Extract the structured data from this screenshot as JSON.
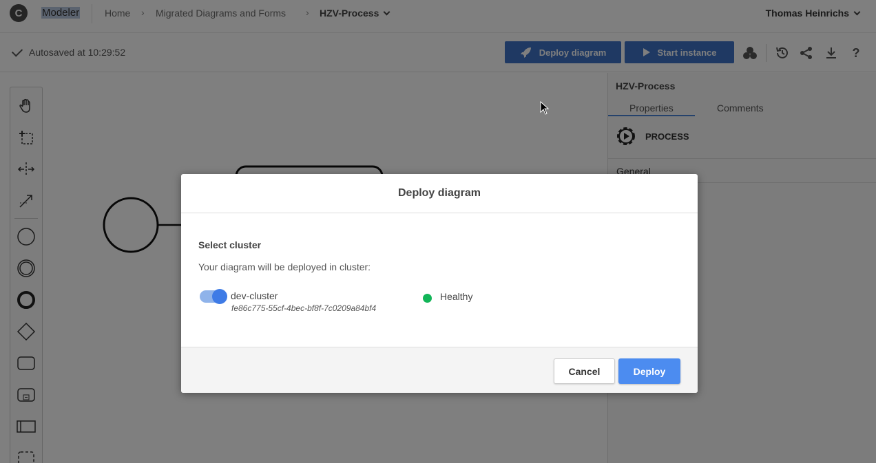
{
  "nav": {
    "logo_letter": "C",
    "app_name": "Modeler",
    "breadcrumbs": [
      "Home",
      "Migrated Diagrams and Forms"
    ],
    "current": "HZV-Process",
    "user": "Thomas Heinrichs"
  },
  "toolbar": {
    "autosave": "Autosaved at 10:29:52",
    "deploy_label": "Deploy diagram",
    "start_label": "Start instance"
  },
  "panel": {
    "title": "HZV-Process",
    "tabs": [
      "Properties",
      "Comments"
    ],
    "heading": "PROCESS",
    "rows": [
      "General"
    ]
  },
  "modal": {
    "title": "Deploy diagram",
    "section_title": "Select cluster",
    "description": "Your diagram will be deployed in cluster:",
    "cluster_name": "dev-cluster",
    "cluster_id": "fe86c775-55cf-4bec-bf8f-7c0209a84bf4",
    "cluster_status": "Healthy",
    "cluster_selected": true,
    "cancel_label": "Cancel",
    "deploy_label": "Deploy"
  },
  "colors": {
    "primary": "#3e73c6",
    "deploy_button": "#4c8cf0",
    "healthy": "#12b558"
  }
}
